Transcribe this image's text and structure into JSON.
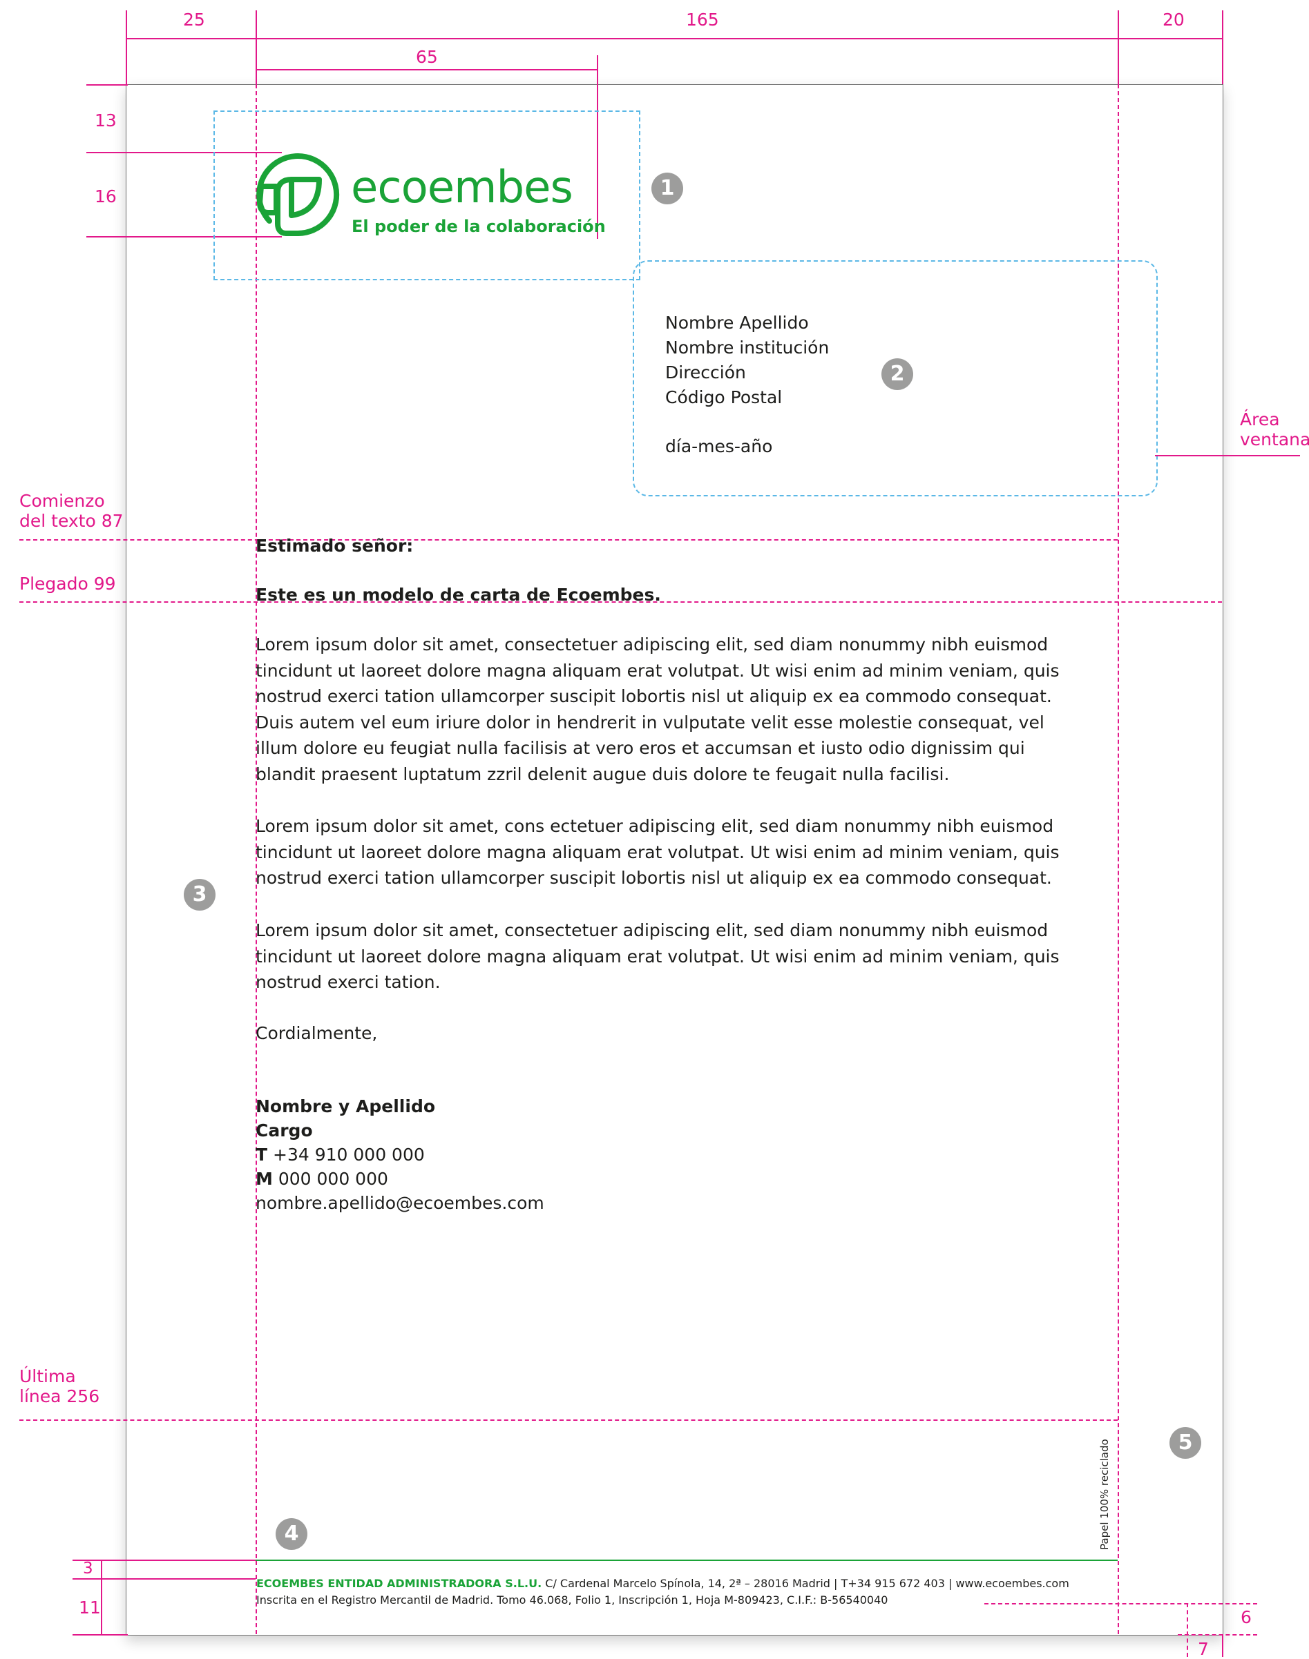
{
  "dimensions": {
    "left_margin": "25",
    "text_width": "165",
    "right_margin": "20",
    "logo_width": "65",
    "logo_top": "13",
    "logo_height": "16",
    "footer_rule": "3",
    "footer_height": "11",
    "footer_right": "6",
    "bottom": "7"
  },
  "side_labels": {
    "text_start_1": "Comienzo",
    "text_start_2": "del texto 87",
    "fold": "Plegado 99",
    "last_line_1": "Última",
    "last_line_2": "línea 256",
    "window_1": "Área",
    "window_2": "ventana"
  },
  "markers": [
    "1",
    "2",
    "3",
    "4",
    "5"
  ],
  "logo": {
    "name": "ecoembes",
    "tagline": "El poder de la colaboración"
  },
  "address_block": {
    "name": "Nombre Apellido",
    "institution": "Nombre institución",
    "address": "Dirección",
    "postal_code": "Código Postal",
    "date": "día-mes-año"
  },
  "letter": {
    "greeting": "Estimado señor:",
    "subject": "Este es un modelo de carta de Ecoembes.",
    "paragraph_1": "Lorem ipsum dolor sit amet, consectetuer adipiscing elit, sed diam nonummy nibh euismod tincidunt ut laoreet dolore magna aliquam erat volutpat. Ut wisi enim ad minim veniam, quis nostrud exerci tation ullamcorper suscipit lobortis nisl ut aliquip ex ea commodo consequat. Duis autem vel eum iriure dolor in hendrerit in vulputate velit esse molestie consequat, vel illum dolore eu feugiat nulla facilisis at vero eros et accumsan et iusto odio dignissim qui blandit praesent luptatum zzril delenit augue duis dolore te feugait nulla facilisi.",
    "paragraph_2": "Lorem ipsum dolor sit amet, cons ectetuer adipiscing elit, sed diam nonummy nibh euismod tincidunt ut laoreet dolore magna aliquam erat volutpat. Ut wisi enim ad minim veniam, quis nostrud exerci tation ullamcorper suscipit lobortis nisl ut aliquip ex ea commodo consequat.",
    "paragraph_3": "Lorem ipsum dolor sit amet, consectetuer adipiscing elit, sed diam nonummy nibh euismod tincidunt ut laoreet dolore magna aliquam erat volutpat. Ut wisi enim ad minim veniam, quis nostrud exerci tation.",
    "closing": "Cordialmente,"
  },
  "signature": {
    "name": "Nombre y Apellido",
    "position": "Cargo",
    "phone_label": "T",
    "phone": "+34 910 000 000",
    "mobile_label": "M",
    "mobile": "000 000 000",
    "email": "nombre.apellido@ecoembes.com"
  },
  "footer": {
    "company": "ECOEMBES ENTIDAD ADMINISTRADORA S.L.U.",
    "address": "C/ Cardenal Marcelo Spínola, 14, 2ª – 28016 Madrid | T+34 915 672 403 | www.ecoembes.com",
    "registry": "Inscrita en el Registro Mercantil de Madrid. Tomo 46.068, Folio 1, Inscripción 1, Hoja M-809423, C.I.F.: B-56540040",
    "recycled": "Papel 100% reciclado"
  },
  "colors": {
    "guide": "#e2188a",
    "brand_green": "#1aa337",
    "window_guide": "#5bb8e6",
    "marker": "#9d9d9c"
  }
}
